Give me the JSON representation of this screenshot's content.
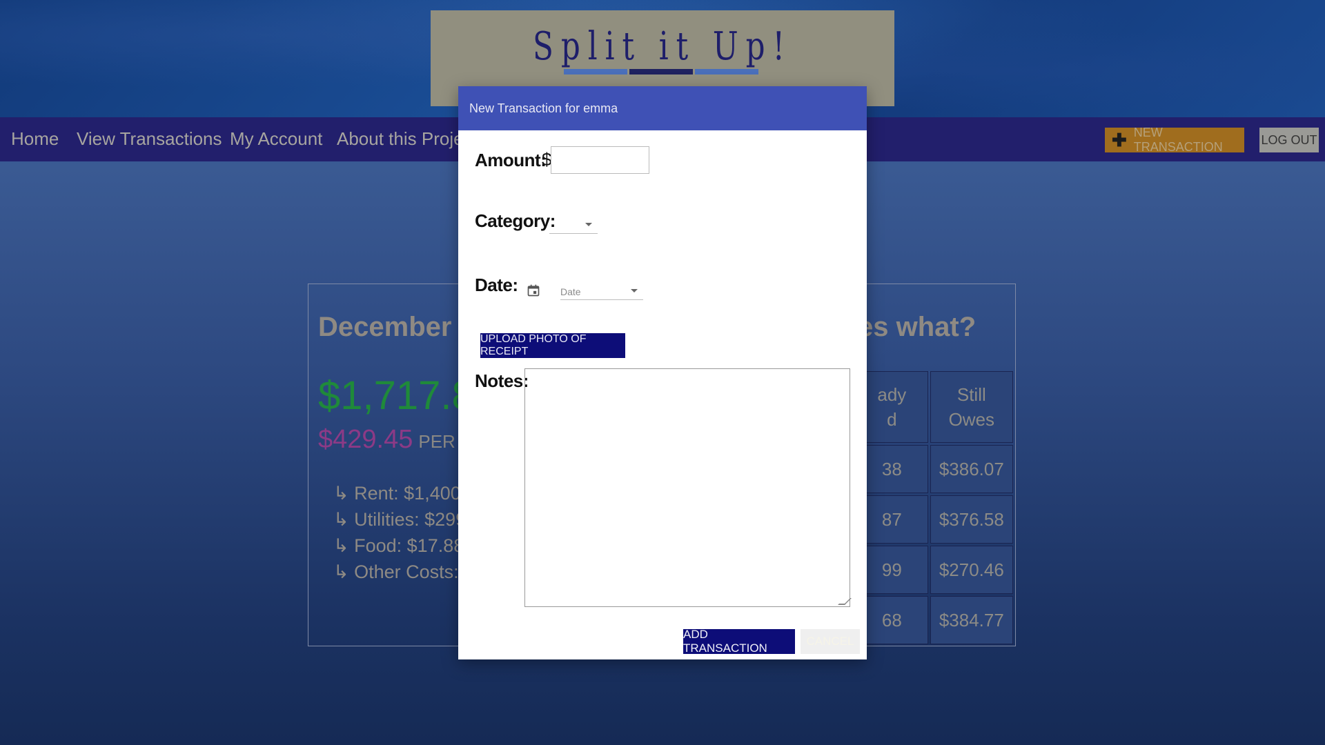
{
  "header": {
    "logo_text": "Split it Up!"
  },
  "nav": {
    "items": [
      "Home",
      "View Transactions",
      "My Account",
      "About this Project"
    ],
    "new_transaction": "NEW TRANSACTION",
    "logout": "LOG OUT"
  },
  "summary": {
    "title_left": "December Co",
    "title_right": "es what?",
    "total": "$1,717.80",
    "per_person_value": "$429.45",
    "per_person_label": "PER PE",
    "breakdown": [
      "↳ Rent: $1,400.0",
      "↳ Utilities: $299.",
      "↳ Food: $17.88",
      "↳ Other Costs: $"
    ],
    "table": {
      "headers": [
        "ady\nd",
        "Still\nOwes"
      ],
      "rows": [
        [
          "38",
          "$386.07"
        ],
        [
          "87",
          "$376.58"
        ],
        [
          "99",
          "$270.46"
        ],
        [
          "68",
          "$384.77"
        ]
      ]
    }
  },
  "modal": {
    "title": "New Transaction for emma",
    "amount_label": "Amount:",
    "currency": "$",
    "amount_value": "",
    "category_label": "Category:",
    "category_value": "",
    "date_label": "Date:",
    "date_placeholder": "Date",
    "upload_button": "UPLOAD PHOTO OF RECEIPT",
    "notes_label": "Notes:",
    "notes_value": "",
    "add_button": "ADD TRANSACTION",
    "cancel_button": "CANCEL"
  },
  "colors": {
    "modal_header": "#3f51b5",
    "primary_button": "#0d0d78",
    "nav_bg": "#221f6c",
    "total_green": "#1f8a3a",
    "per_person_purple": "#8c3a86",
    "new_tx_orange": "#a06d1e"
  }
}
